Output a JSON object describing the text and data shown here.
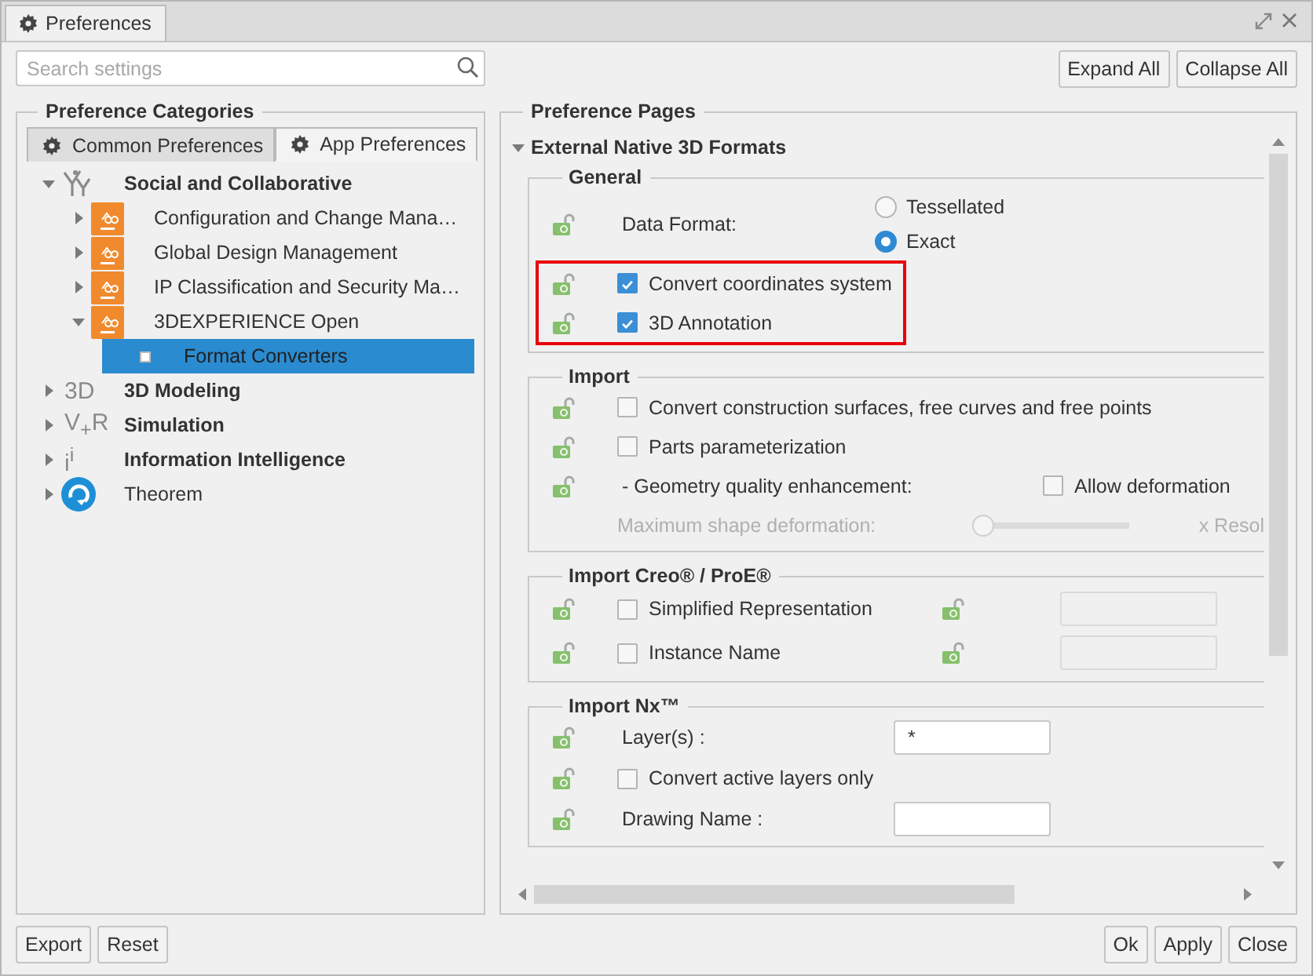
{
  "window": {
    "title": "Preferences"
  },
  "search": {
    "placeholder": "Search settings"
  },
  "top_buttons": [
    "Expand All",
    "Collapse All"
  ],
  "categories": {
    "title": "Preference Categories",
    "tabs": [
      {
        "label": "Common Preferences",
        "selected": false
      },
      {
        "label": "App Preferences",
        "selected": true
      }
    ],
    "tree": [
      {
        "label": "Social and Collaborative",
        "kind": "group",
        "bold": true,
        "expanded": true,
        "selected": false,
        "children": [
          {
            "label": "Configuration and Change Mana…",
            "kind": "app",
            "bold": false,
            "expanded": false,
            "selected": false
          },
          {
            "label": "Global Design Management",
            "kind": "app",
            "bold": false,
            "expanded": false,
            "selected": false
          },
          {
            "label": "IP Classification and Security Ma…",
            "kind": "app",
            "bold": false,
            "expanded": false,
            "selected": false
          },
          {
            "label": "3DEXPERIENCE Open",
            "kind": "app",
            "bold": false,
            "expanded": true,
            "selected": false,
            "children": [
              {
                "label": "Format Converters",
                "kind": "page",
                "bold": false,
                "selected": true
              }
            ]
          }
        ]
      },
      {
        "label": "3D Modeling",
        "kind": "module",
        "icon_text": "3D",
        "bold": true,
        "expanded": false,
        "selected": false
      },
      {
        "label": "Simulation",
        "kind": "module",
        "icon_text": "V$_{+}$R",
        "bold": true,
        "expanded": false,
        "selected": false
      },
      {
        "label": "Information Intelligence",
        "kind": "module",
        "icon_text": "i$^{i}$",
        "bold": true,
        "expanded": false,
        "selected": false
      },
      {
        "label": "Theorem",
        "kind": "product",
        "bold": false,
        "expanded": false,
        "selected": false
      }
    ]
  },
  "pages": {
    "title": "Preference Pages",
    "section": {
      "label": "External Native 3D Formats",
      "expanded": true
    },
    "groups": [
      {
        "title": "General",
        "rows": [
          {
            "kind": "radio",
            "label": "Data Format:",
            "options": [
              {
                "label": "Tessellated",
                "selected": false
              },
              {
                "label": "Exact",
                "selected": true
              }
            ]
          },
          {
            "kind": "highlight",
            "rows": [
              {
                "kind": "checkbox",
                "label": "Convert coordinates system",
                "checked": true
              },
              {
                "kind": "checkbox",
                "label": "3D Annotation",
                "checked": true
              }
            ]
          }
        ]
      },
      {
        "title": "Import",
        "rows": [
          {
            "kind": "checkbox",
            "label": "Convert construction surfaces, free curves and free points",
            "checked": false
          },
          {
            "kind": "checkbox",
            "label": "Parts parameterization",
            "checked": false
          },
          {
            "kind": "checkbox_option",
            "label": "- Geometry quality enhancement:",
            "option": {
              "label": "Allow deformation",
              "checked": false
            }
          },
          {
            "kind": "slider",
            "label": "Maximum shape deformation:",
            "level": 0,
            "disabled": true,
            "unit": "x Resol"
          }
        ]
      },
      {
        "title": "Import Creo® / ProE®",
        "rows": [
          {
            "kind": "checkbox_field",
            "label": "Simplified Representation",
            "checked": false,
            "field": {
              "disabled": true
            }
          },
          {
            "kind": "checkbox_field",
            "label": "Instance Name",
            "checked": false,
            "field": {
              "disabled": true
            }
          }
        ]
      },
      {
        "title": "Import Nx™",
        "rows": [
          {
            "kind": "field",
            "label": "Layer(s) :",
            "field": {
              "value": "*",
              "disabled": false
            }
          },
          {
            "kind": "checkbox",
            "label": "Convert active layers only",
            "checked": false
          },
          {
            "kind": "field",
            "label": "Drawing Name :",
            "field": {
              "disabled": false
            }
          }
        ]
      }
    ]
  },
  "left_buttons": [
    "Export",
    "Reset"
  ],
  "right_buttons": [
    "Ok",
    "Apply",
    "Close"
  ]
}
